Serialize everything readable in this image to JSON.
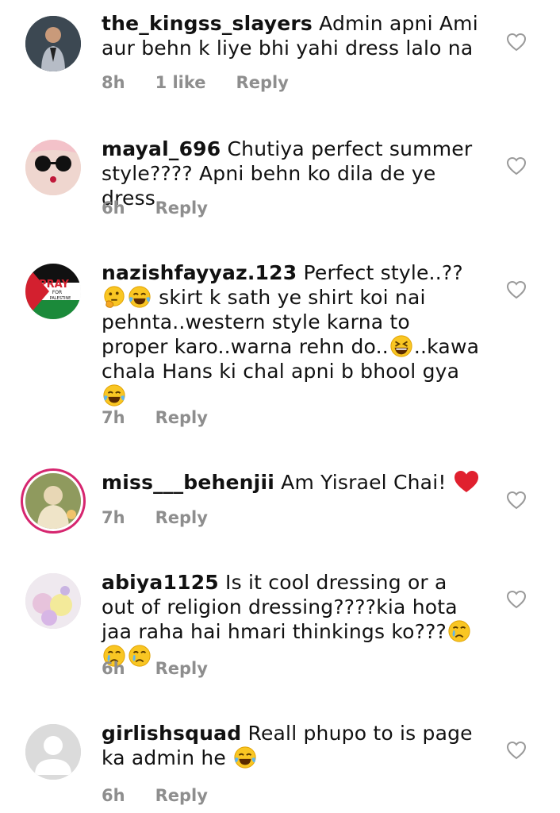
{
  "comments": [
    {
      "username": "the_kingss_slayers",
      "text": " Admin apni Ami aur behn k liye bhi yahi dress lalo na",
      "time": "8h",
      "likes": "1 like",
      "reply": "Reply"
    },
    {
      "username": "mayal_696",
      "text": " Chutiya perfect summer style???? Apni behn ko dila de ye dress",
      "time": "6h",
      "reply": "Reply"
    },
    {
      "username": "nazishfayyaz.123",
      "text_a": " Perfect style..?? ",
      "text_b": " skirt k sath ye shirt koi nai pehnta..western style karna to proper karo..warna rehn do..",
      "text_c": "..kawa chala Hans ki chal apni b bhool gya",
      "time": "7h",
      "reply": "Reply",
      "avatar_text_top": "PRAY",
      "avatar_text_mid": "FOR",
      "avatar_text_bottom": "PALESTINE"
    },
    {
      "username": "miss___behenjii",
      "text": " Am Yisrael Chai! ",
      "time": "7h",
      "reply": "Reply"
    },
    {
      "username": "abiya1125",
      "text": " Is it cool dressing or a out of religion dressing????kia hota jaa raha hai hmari thinkings ko???",
      "time": "6h",
      "reply": "Reply"
    },
    {
      "username": "girlishsquad",
      "text": " Reall phupo to is page ka admin he ",
      "time": "6h",
      "reply": "Reply"
    }
  ],
  "icons": {
    "like": "heart-outline-icon",
    "laugh": "face-with-tears-of-joy-icon",
    "think": "thinking-face-icon",
    "grin": "grinning-squinting-face-icon",
    "cry": "crying-face-icon",
    "red_heart": "red-heart-icon"
  },
  "colors": {
    "meta": "#8e8e8e",
    "story_ring": "#d6266f",
    "heart": "#e0202e"
  }
}
